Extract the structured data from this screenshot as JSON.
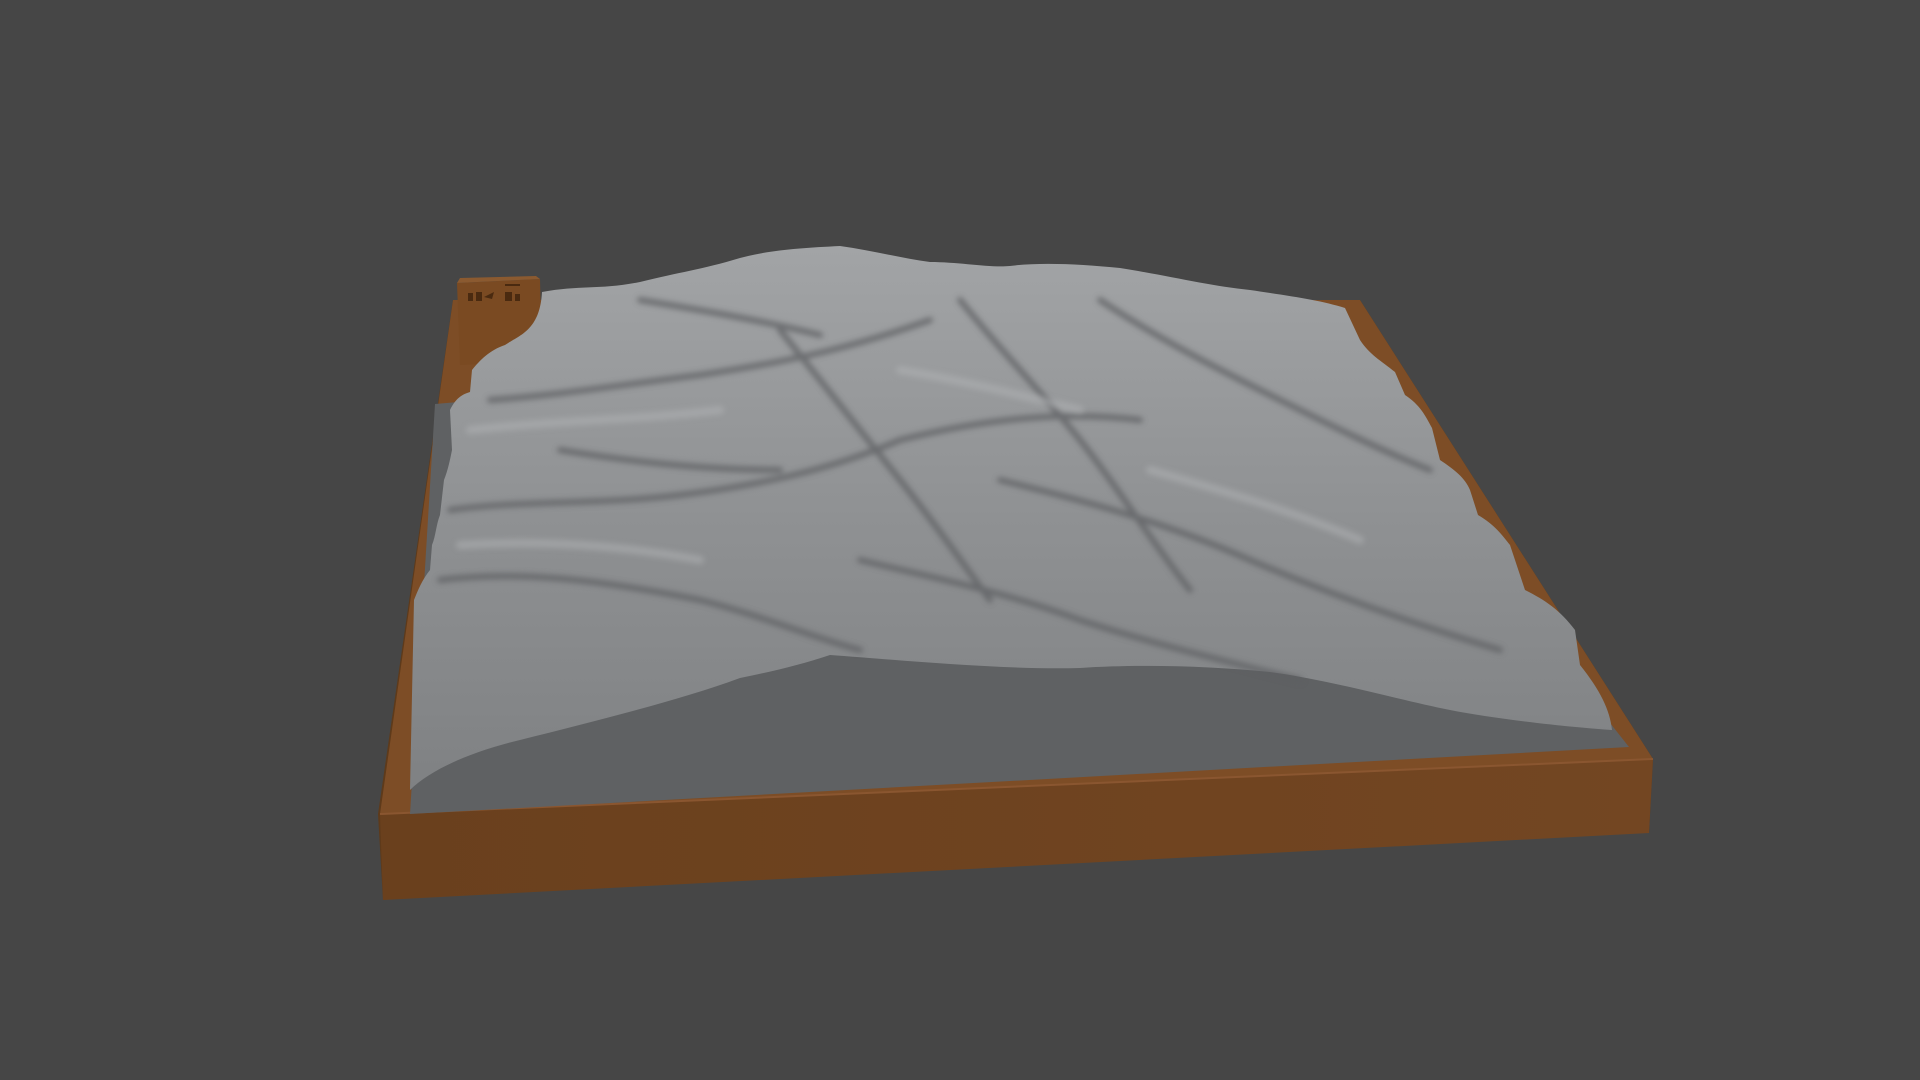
{
  "viewport": {
    "background_color": "#464646"
  },
  "model": {
    "base_color": "#6e4320",
    "base_top_color": "#7d4d26",
    "floor_color": "#5f6163",
    "terrain_color": "#8e9092",
    "terrain_shadow_color": "#5d5f62",
    "label_block_color": "#7a4a22"
  }
}
